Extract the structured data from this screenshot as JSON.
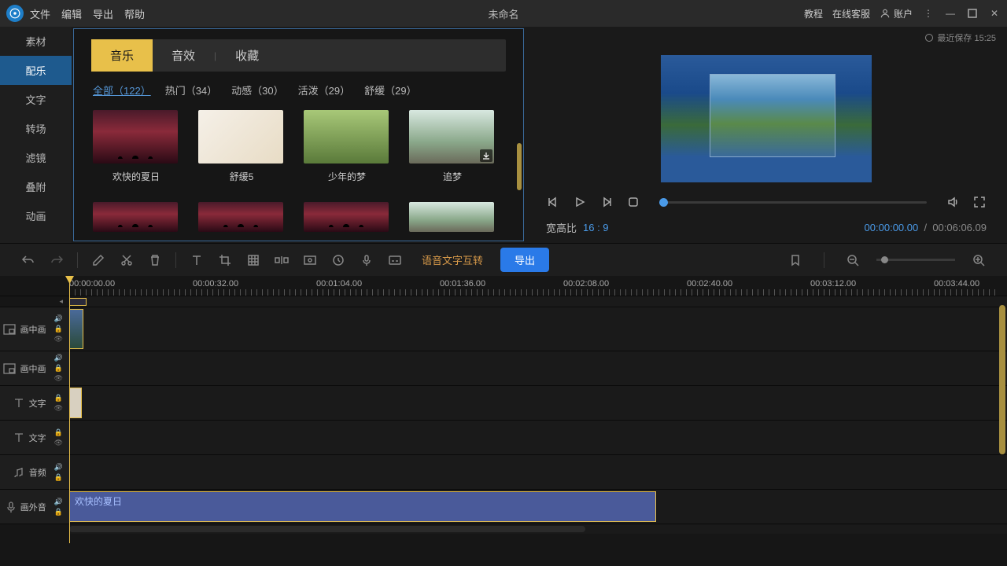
{
  "titlebar": {
    "menus": [
      "文件",
      "编辑",
      "导出",
      "帮助"
    ],
    "title": "未命名",
    "right": {
      "tutorial": "教程",
      "support": "在线客服",
      "account": "账户"
    }
  },
  "save": {
    "label": "最近保存",
    "time": "15:25"
  },
  "sidebar": {
    "items": [
      "素材",
      "配乐",
      "文字",
      "转场",
      "滤镜",
      "叠附",
      "动画"
    ],
    "active": 1
  },
  "tabs": {
    "items": [
      "音乐",
      "音效",
      "收藏"
    ],
    "active": 0
  },
  "filters": [
    {
      "label": "全部（122）",
      "active": true
    },
    {
      "label": "热门（34）"
    },
    {
      "label": "动感（30）"
    },
    {
      "label": "活泼（29）"
    },
    {
      "label": "舒缓（29）"
    }
  ],
  "media": {
    "row1": [
      {
        "name": "欢快的夏日",
        "art": "th-concert"
      },
      {
        "name": "舒缓5",
        "art": "th-flowers"
      },
      {
        "name": "少年的梦",
        "art": "th-green"
      },
      {
        "name": "追梦",
        "art": "th-road",
        "download": true
      }
    ]
  },
  "preview": {
    "aspect_label": "宽高比",
    "aspect": "16 : 9",
    "current": "00:00:00.00",
    "total": "00:06:06.09"
  },
  "toolbar": {
    "voice": "语音文字互转",
    "export": "导出"
  },
  "ruler": [
    "00:00:00.00",
    "00:00:32.00",
    "00:01:04.00",
    "00:01:36.00",
    "00:02:08.00",
    "00:02:40.00",
    "00:03:12.00",
    "00:03:44.00"
  ],
  "tracks": {
    "pip": "画中画",
    "text": "文字",
    "audio": "音频",
    "voiceover": "画外音"
  },
  "clip": {
    "audio_name": "欢快的夏日"
  }
}
